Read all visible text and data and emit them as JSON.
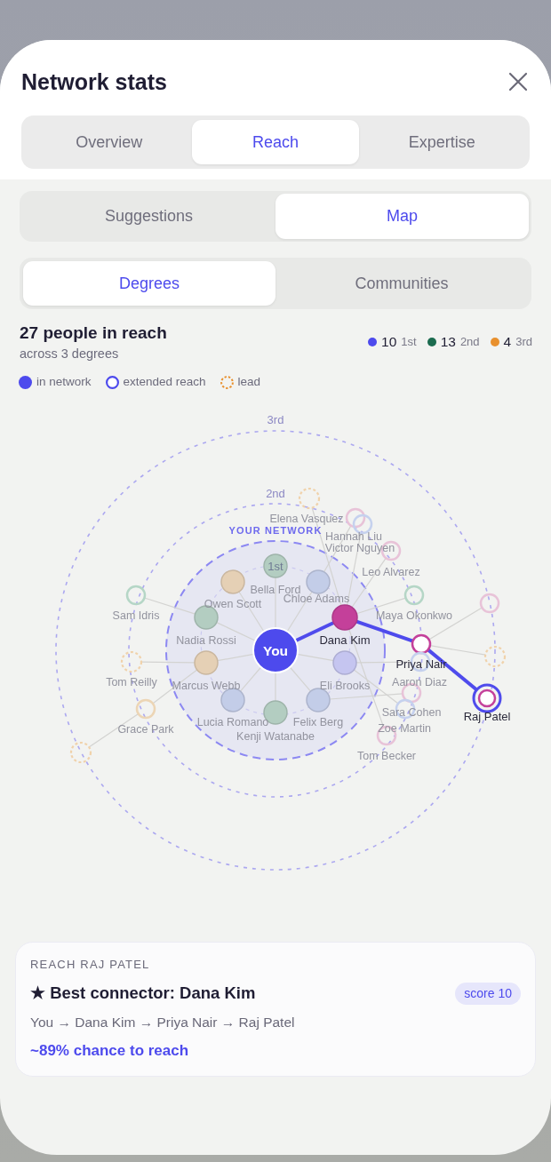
{
  "sheet": {
    "title": "Network stats"
  },
  "tabs": [
    {
      "label": "Overview",
      "selected": false
    },
    {
      "label": "Reach",
      "selected": true
    },
    {
      "label": "Expertise",
      "selected": false
    }
  ],
  "view_tabs": [
    {
      "label": "Suggestions",
      "selected": false
    },
    {
      "label": "Map",
      "selected": true
    }
  ],
  "mode_tabs": [
    {
      "label": "Degrees",
      "selected": true
    },
    {
      "label": "Communities",
      "selected": false
    }
  ],
  "summary": {
    "title": "27 people in reach",
    "subtitle": "across 3 degrees",
    "degree_counts": [
      {
        "count": "10",
        "label": "1st",
        "color": "#4d4aed"
      },
      {
        "count": "13",
        "label": "2nd",
        "color": "#1b6b4f"
      },
      {
        "count": "4",
        "label": "3rd",
        "color": "#e8902e"
      }
    ]
  },
  "legend": [
    {
      "kind": "network",
      "label": "in network"
    },
    {
      "kind": "extended",
      "label": "extended reach"
    },
    {
      "kind": "lead",
      "label": "lead"
    }
  ],
  "map": {
    "rings": [
      {
        "label": "3rd",
        "nodes": [
          {
            "kind": "extended",
            "color": "#e8c3d8",
            "on_path": false,
            "selected": false
          },
          {
            "kind": "lead",
            "color": "#f0d2ab",
            "on_path": false,
            "selected": false
          },
          {
            "name": "Raj Patel",
            "kind": "extended",
            "color": "#c4409a",
            "on_path": true,
            "selected": true
          },
          {
            "kind": "lead",
            "color": "#f0d2ab",
            "on_path": false,
            "selected": false
          }
        ]
      },
      {
        "label": "2nd",
        "nodes": [
          {
            "name": "Elena Vasquez",
            "kind": "lead",
            "color": "#f0d2ab",
            "on_path": false,
            "selected": false
          },
          {
            "name": "Hannah Liu",
            "kind": "extended",
            "color": "#e8c3d8",
            "on_path": false,
            "selected": false
          },
          {
            "name": "Victor Nguyen",
            "kind": "extended",
            "color": "#c5d1ee",
            "on_path": false,
            "selected": false
          },
          {
            "name": "Leo Alvarez",
            "kind": "extended",
            "color": "#e8c3d8",
            "on_path": false,
            "selected": false
          },
          {
            "name": "Sam Idris",
            "kind": "extended",
            "color": "#b5d6c6",
            "on_path": false,
            "selected": false
          },
          {
            "name": "Maya Okonkwo",
            "kind": "extended",
            "color": "#b5d6c6",
            "on_path": false,
            "selected": false
          },
          {
            "name": "Priya Nair",
            "kind": "extended",
            "color": "#c4409a",
            "on_path": true,
            "selected": false
          },
          {
            "name": "Tom Reilly",
            "kind": "lead",
            "color": "#f0d2ab",
            "on_path": false,
            "selected": false
          },
          {
            "name": "Aaron Diaz",
            "kind": "extended",
            "color": "#c5d1ee",
            "on_path": false,
            "selected": false
          },
          {
            "name": "Sara Cohen",
            "kind": "extended",
            "color": "#e8c3d8",
            "on_path": false,
            "selected": false
          },
          {
            "name": "Grace Park",
            "kind": "extended",
            "color": "#ecd5b5",
            "on_path": false,
            "selected": false
          },
          {
            "name": "Zoe Martin",
            "kind": "extended",
            "color": "#c5d1ee",
            "on_path": false,
            "selected": false
          },
          {
            "name": "Tom Becker",
            "kind": "extended",
            "color": "#e8c3d8",
            "on_path": false,
            "selected": false
          }
        ]
      },
      {
        "label": "1st",
        "nodes": [
          {
            "name": "Bella Ford",
            "kind": "network",
            "color": "#b3cdc1",
            "on_path": false,
            "selected": false
          },
          {
            "name": "Owen Scott",
            "kind": "network",
            "color": "#e5d0b5",
            "on_path": false,
            "selected": false
          },
          {
            "name": "Chloe Adams",
            "kind": "network",
            "color": "#c3cde8",
            "on_path": false,
            "selected": false
          },
          {
            "name": "Nadia Rossi",
            "kind": "network",
            "color": "#b3cdc1",
            "on_path": false,
            "selected": false
          },
          {
            "name": "Dana Kim",
            "kind": "network",
            "color": "#c4409a",
            "on_path": true,
            "selected": false
          },
          {
            "name": "Marcus Webb",
            "kind": "network",
            "color": "#e5d0b5",
            "on_path": false,
            "selected": false
          },
          {
            "name": "Eli Brooks",
            "kind": "network",
            "color": "#c5c5f0",
            "on_path": false,
            "selected": false
          },
          {
            "name": "Lucia Romano",
            "kind": "network",
            "color": "#c3cde8",
            "on_path": false,
            "selected": false
          },
          {
            "name": "Felix Berg",
            "kind": "network",
            "color": "#c3cde8",
            "on_path": false,
            "selected": false
          },
          {
            "name": "Kenji Watanabe",
            "kind": "network",
            "color": "#b3cdc1",
            "on_path": false,
            "selected": false
          }
        ]
      }
    ],
    "network_label": "YOUR NETWORK",
    "center_label": "You"
  },
  "reach_card": {
    "heading": "REACH RAJ PATEL",
    "title": "★ Best connector: Dana Kim",
    "badge": "score 10",
    "route": "You → Dana Kim → Priya Nair → Raj Patel",
    "chance": "~89% chance to reach"
  }
}
